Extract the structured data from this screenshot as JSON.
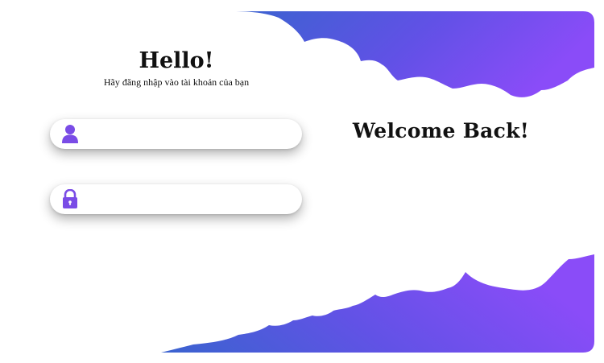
{
  "login": {
    "title": "Hello!",
    "subtitle": "Hãy đăng nhập vào tài khoản của bạn",
    "username": {
      "value": "",
      "placeholder": "",
      "icon": "user-icon"
    },
    "password": {
      "value": "",
      "placeholder": "",
      "icon": "lock-icon"
    }
  },
  "panel": {
    "heading": "Welcome Back!"
  },
  "colors": {
    "gradient_start": "#3a63cf",
    "gradient_mid": "#6151e6",
    "gradient_end": "#8a4cf8",
    "icon": "#7a4ce6",
    "text": "#111111"
  }
}
